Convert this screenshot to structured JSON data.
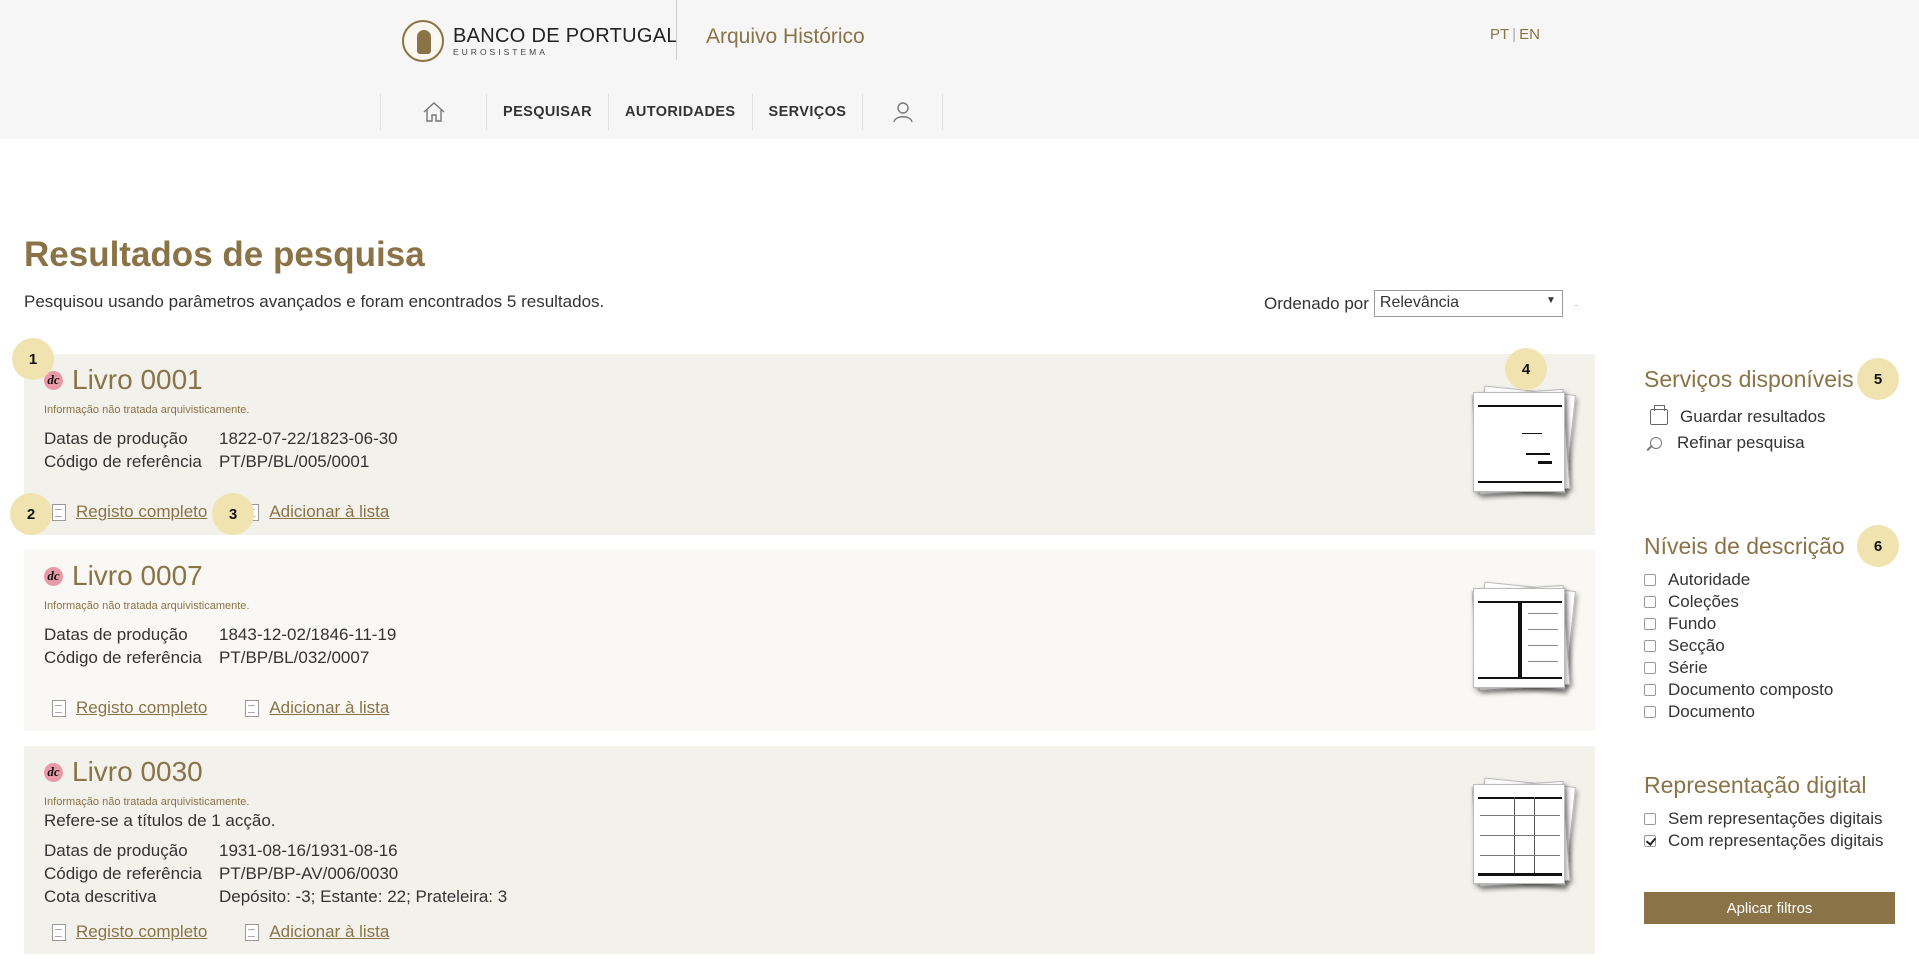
{
  "header": {
    "logo_main": "BANCO DE PORTUGAL",
    "logo_sub": "EUROSISTEMA",
    "archive_title": "Arquivo Histórico",
    "lang_pt": "PT",
    "lang_sep": "|",
    "lang_en": "EN"
  },
  "nav": {
    "home_icon": "home-icon",
    "items": [
      "PESQUISAR",
      "AUTORIDADES",
      "SERVIÇOS"
    ],
    "user_icon": "user-icon"
  },
  "main": {
    "title": "Resultados de pesquisa",
    "summary": "Pesquisou usando parâmetros avançados e foram encontrados 5 resultados.",
    "sort_label": "Ordenado por",
    "sort_value": "Relevância",
    "sort_arrow": "▼",
    "sort_dash": "-"
  },
  "results": [
    {
      "icon_text": "dc",
      "title": "Livro 0001",
      "note": "Informação não tratada arquivisticamente.",
      "fields": [
        {
          "label": "Datas de produção",
          "value": "1822-07-22/1823-06-30"
        },
        {
          "label": "Código de referência",
          "value": "PT/BP/BL/005/0001"
        }
      ],
      "action_full": "Registo completo",
      "action_add": "Adicionar à lista"
    },
    {
      "icon_text": "dc",
      "title": "Livro 0007",
      "note": "Informação não tratada arquivisticamente.",
      "fields": [
        {
          "label": "Datas de produção",
          "value": "1843-12-02/1846-11-19"
        },
        {
          "label": "Código de referência",
          "value": "PT/BP/BL/032/0007"
        }
      ],
      "action_full": "Registo completo",
      "action_add": "Adicionar à lista"
    },
    {
      "icon_text": "dc",
      "title": "Livro 0030",
      "note": "Informação não tratada arquivisticamente.",
      "description": "Refere-se a títulos de 1 acção.",
      "fields": [
        {
          "label": "Datas de produção",
          "value": "1931-08-16/1931-08-16"
        },
        {
          "label": "Código de referência",
          "value": "PT/BP/BP-AV/006/0030"
        },
        {
          "label": "Cota descritiva",
          "value": "Depósito: -3; Estante: 22; Prateleira: 3"
        }
      ],
      "action_full": "Registo completo",
      "action_add": "Adicionar à lista"
    }
  ],
  "badges": [
    "1",
    "2",
    "3",
    "4",
    "5",
    "6"
  ],
  "sidebar": {
    "services_title": "Serviços disponíveis",
    "services": [
      "Guardar resultados",
      "Refinar pesquisa"
    ],
    "levels_title": "Níveis de descrição",
    "levels": [
      "Autoridade",
      "Coleções",
      "Fundo",
      "Secção",
      "Série",
      "Documento composto",
      "Documento"
    ],
    "digital_title": "Representação digital",
    "digital": [
      {
        "label": "Sem representações digitais",
        "checked": false
      },
      {
        "label": "Com representações digitais",
        "checked": true
      }
    ],
    "apply_label": "Aplicar filtros"
  },
  "colors": {
    "accent": "#8a7346",
    "badge": "#f0e3b0",
    "result_bg": "#f3f1ec"
  }
}
